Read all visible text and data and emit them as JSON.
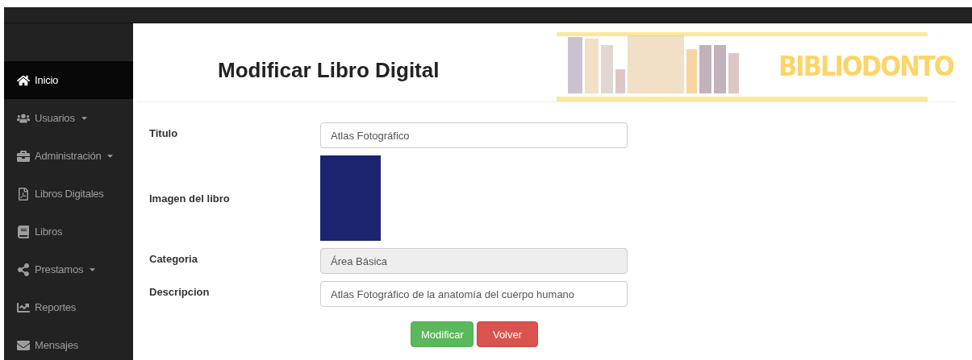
{
  "sidebar": {
    "items": [
      {
        "label": "Inicio",
        "selected": true,
        "dropdown": false
      },
      {
        "label": "Usuarios",
        "selected": false,
        "dropdown": true
      },
      {
        "label": "Administración",
        "selected": false,
        "dropdown": true
      },
      {
        "label": "Libros Digitales",
        "selected": false,
        "dropdown": false
      },
      {
        "label": "Libros",
        "selected": false,
        "dropdown": false
      },
      {
        "label": "Prestamos",
        "selected": false,
        "dropdown": true
      },
      {
        "label": "Reportes",
        "selected": false,
        "dropdown": false
      },
      {
        "label": "Mensajes",
        "selected": false,
        "dropdown": false
      }
    ]
  },
  "header": {
    "title": "Modificar Libro Digital",
    "banner_logo": "BIBLIODONTO"
  },
  "form": {
    "fields": [
      {
        "kind": "text",
        "label": "Titulo",
        "value": "Atlas Fotográfico",
        "disabled": false
      },
      {
        "kind": "image",
        "label": "Imagen del libro"
      },
      {
        "kind": "text",
        "label": "Categoria",
        "value": "Área Básica",
        "disabled": true
      },
      {
        "kind": "text",
        "label": "Descripcion",
        "value": "Atlas Fotográfico de la anatomía del cuerpo humano",
        "disabled": false
      }
    ],
    "buttons": [
      {
        "label": "Modificar",
        "kind": "success"
      },
      {
        "label": "Volver",
        "kind": "danger"
      }
    ]
  }
}
